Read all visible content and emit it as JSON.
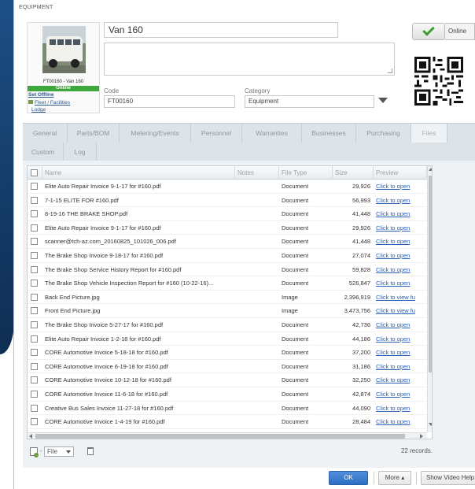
{
  "header": {
    "title": "EQUIPMENT"
  },
  "asset": {
    "name": "Van 160",
    "photo_caption": "FT00160 - Van 160",
    "status": "Online",
    "set_offline_label": "Set Offline",
    "fleet_link": "Fleet / Facilities",
    "lodge_link": "Lodge",
    "code_label": "Code",
    "code": "FT00160",
    "category_label": "Category",
    "category": "Equipment",
    "online_toggle_label": "Online"
  },
  "tabs": {
    "row1": [
      "General",
      "Parts/BOM",
      "Metering/Events",
      "Personnel",
      "Warranties",
      "Businesses",
      "Purchasing",
      "Files"
    ],
    "row2": [
      "Custom",
      "Log"
    ],
    "active": "Files"
  },
  "files": {
    "columns": {
      "name": "Name",
      "notes": "Notes",
      "type": "File Type",
      "size": "Size",
      "preview": "Preview"
    },
    "rows": [
      {
        "name": "Elite Auto Repair Invoice 9-1-17 for #160.pdf",
        "type": "Document",
        "size": "29,926",
        "preview": "Click to open"
      },
      {
        "name": "7-1-15 ELITE FOR #160.pdf",
        "type": "Document",
        "size": "56,993",
        "preview": "Click to open"
      },
      {
        "name": "8-19-16 THE BRAKE SHOP.pdf",
        "type": "Document",
        "size": "41,448",
        "preview": "Click to open"
      },
      {
        "name": "Elite Auto Repair Invoice 9-1-17 for #160.pdf",
        "type": "Document",
        "size": "29,926",
        "preview": "Click to open"
      },
      {
        "name": "scanner@tch-az.com_20160825_101026_006.pdf",
        "type": "Document",
        "size": "41,448",
        "preview": "Click to open"
      },
      {
        "name": "The Brake Shop Invoice 9-18-17 for #160.pdf",
        "type": "Document",
        "size": "27,074",
        "preview": "Click to open"
      },
      {
        "name": "The Brake Shop Service History Report for #160.pdf",
        "type": "Document",
        "size": "59,828",
        "preview": "Click to open"
      },
      {
        "name": "The Brake Shop Vehicle Inspection Report for #160 (10-22-16)...",
        "type": "Document",
        "size": "526,847",
        "preview": "Click to open"
      },
      {
        "name": "Back End Picture.jpg",
        "type": "Image",
        "size": "2,396,919",
        "preview": "Click to view fu"
      },
      {
        "name": "Front End Picture.jpg",
        "type": "Image",
        "size": "3,473,756",
        "preview": "Click to view fu"
      },
      {
        "name": "The Brake Shop Invoice 5-27-17 for #160.pdf",
        "type": "Document",
        "size": "42,736",
        "preview": "Click to open"
      },
      {
        "name": "Elite Auto Repair Invoice 1-2-18 for #160.pdf",
        "type": "Document",
        "size": "44,186",
        "preview": "Click to open"
      },
      {
        "name": "CORE Automotive Invoice 5-18-18 for #160.pdf",
        "type": "Document",
        "size": "37,200",
        "preview": "Click to open"
      },
      {
        "name": "CORE Automotive Invoice 6-19-18 for #160.pdf",
        "type": "Document",
        "size": "31,186",
        "preview": "Click to open"
      },
      {
        "name": "CORE Automotive Invoice 10-12-18 for #160.pdf",
        "type": "Document",
        "size": "32,250",
        "preview": "Click to open"
      },
      {
        "name": "CORE Automotive Invoice 11-6-18 for #160.pdf",
        "type": "Document",
        "size": "42,874",
        "preview": "Click to open"
      },
      {
        "name": "Creative Bus Sales Invoice 11-27-18 for #160.pdf",
        "type": "Document",
        "size": "44,090",
        "preview": "Click to open"
      },
      {
        "name": "CORE Automotive Invoice 1-4-19 for #160.pdf",
        "type": "Document",
        "size": "28,484",
        "preview": "Click to open"
      }
    ],
    "file_menu_label": "File",
    "record_count": "22 records."
  },
  "footer": {
    "ok_label": "OK",
    "more_label": "More ▴",
    "video_help_label": "Show Video Help"
  },
  "icons": {
    "check": "check-icon",
    "add_file": "add-file-icon",
    "trash": "trash-icon",
    "fleet": "fleet-icon",
    "qr": "qr-code-icon"
  },
  "colors": {
    "online_green": "#3da93d",
    "link_blue": "#2a62b8",
    "ok_blue": "#2f6fc2"
  }
}
